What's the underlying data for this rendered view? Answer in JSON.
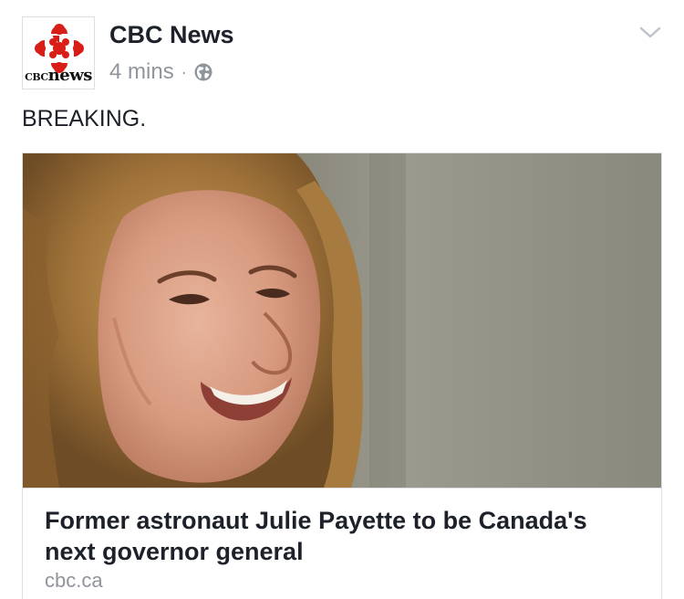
{
  "post": {
    "page_name": "CBC News",
    "timestamp": "4 mins",
    "separator": "·",
    "privacy_icon": "globe-icon",
    "options_icon": "chevron-down-icon",
    "text": "BREAKING."
  },
  "avatar": {
    "logo_icon": "cbc-gem-logo",
    "wordmark_cbc": "CBC",
    "wordmark_news": "news"
  },
  "link": {
    "image_description": "photo",
    "title": "Former astronaut Julie Payette to be Canada's next governor general",
    "domain": "cbc.ca"
  },
  "colors": {
    "brand_red": "#d91e18",
    "primary_text": "#1d2129",
    "secondary_text": "#90949c",
    "border": "#dddfe2"
  }
}
